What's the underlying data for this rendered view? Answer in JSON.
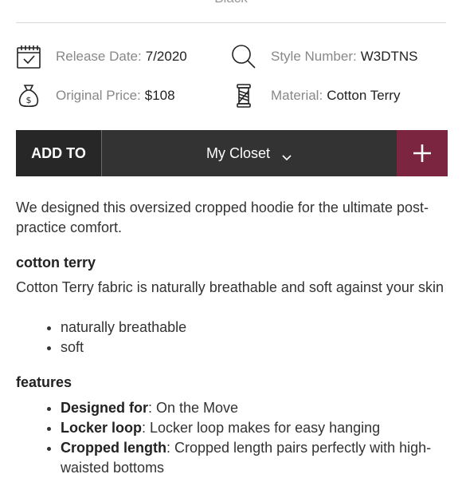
{
  "product": {
    "color_name": "Black"
  },
  "specs": {
    "release_date": {
      "label": "Release Date:",
      "value": "7/2020",
      "icon": "calendar-check-icon"
    },
    "style_number": {
      "label": "Style Number:",
      "value": "W3DTNS",
      "icon": "search-icon"
    },
    "original_price": {
      "label": "Original Price:",
      "value": "$108",
      "icon": "money-bag-icon"
    },
    "material": {
      "label": "Material:",
      "value": "Cotton Terry",
      "icon": "thread-spool-icon"
    }
  },
  "add_to_bar": {
    "add_to_label": "ADD TO",
    "closet_label": "My Closet",
    "plus_label": "+",
    "accent_color": "#7b2541"
  },
  "description": {
    "intro": "We designed this oversized cropped hoodie for the ultimate post-practice comfort.",
    "fabric_heading": "cotton terry",
    "fabric_text": "Cotton Terry fabric is naturally breathable and soft against your skin",
    "fabric_bullets": [
      "naturally breathable",
      "soft"
    ],
    "features_heading": "features",
    "features": [
      {
        "name": "Designed for",
        "text": ": On the Move"
      },
      {
        "name": "Locker loop",
        "text": ": Locker loop makes for easy hanging"
      },
      {
        "name": "Cropped length",
        "text": ": Cropped length pairs perfectly with high-waisted bottoms"
      }
    ]
  }
}
